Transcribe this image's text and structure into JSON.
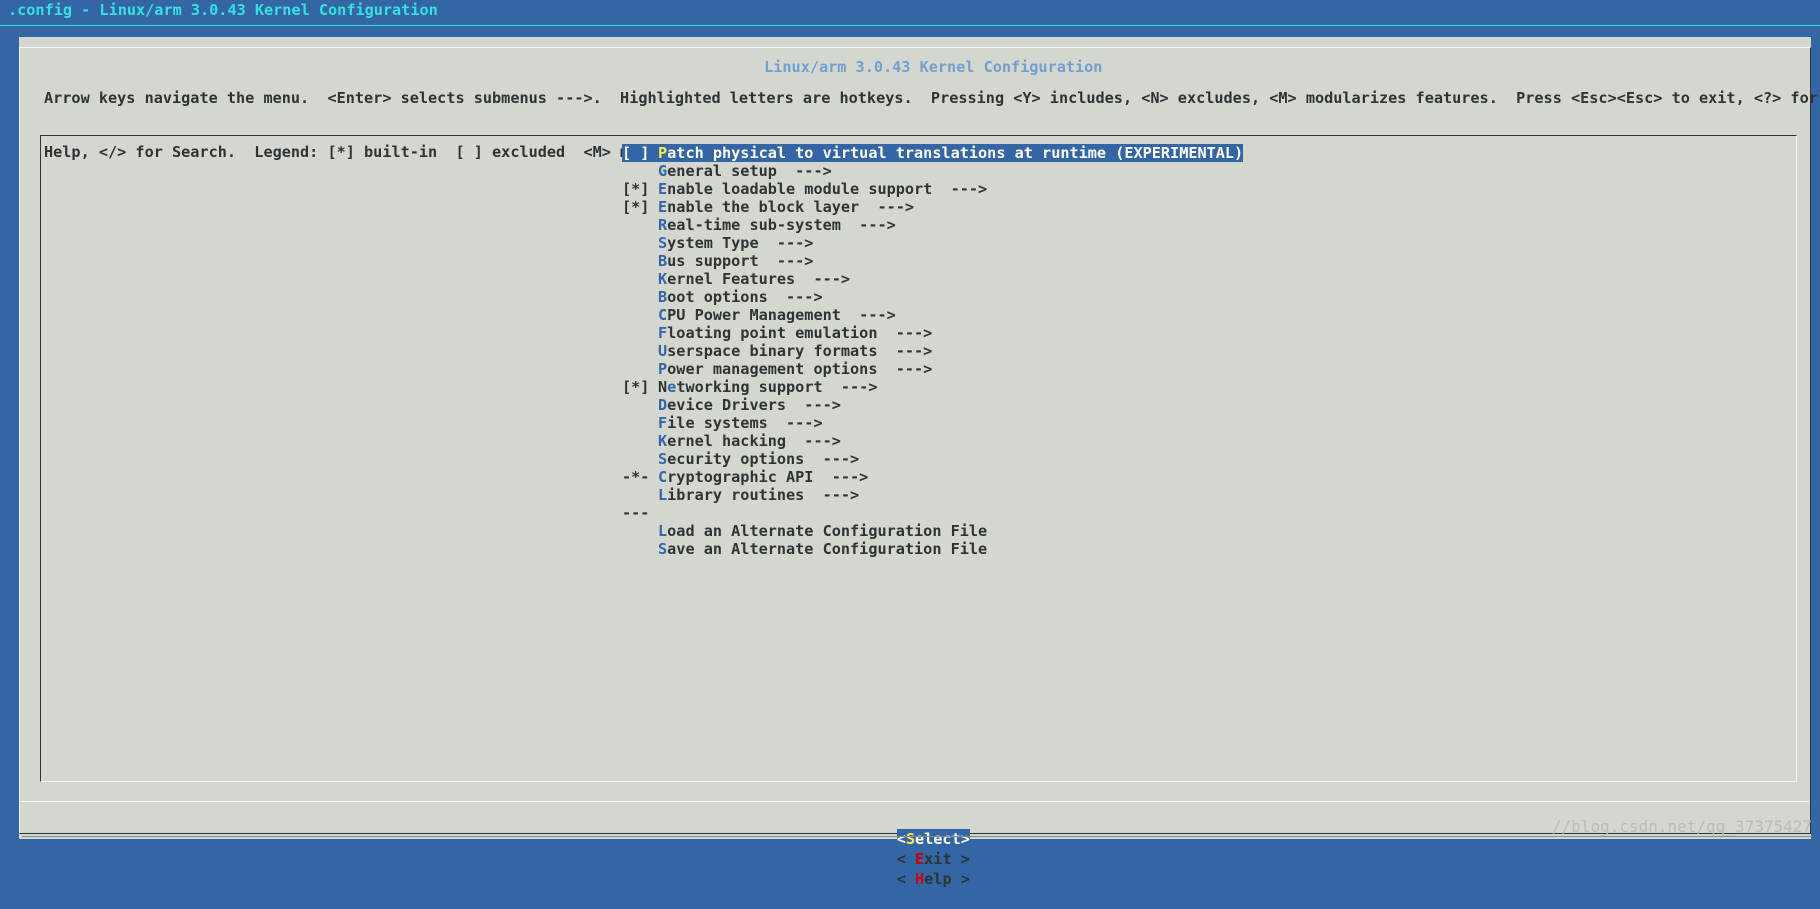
{
  "window": {
    "title": ".config - Linux/arm 3.0.43 Kernel Configuration"
  },
  "dialog": {
    "title": "Linux/arm 3.0.43 Kernel Configuration",
    "instructions": [
      "Arrow keys navigate the menu.  <Enter> selects submenus --->.  Highlighted letters are hotkeys.  Pressing <Y> includes, <N> excludes, <M> modularizes features.  Press <Esc><Esc> to exit, <?> for",
      "Help, </> for Search.  Legend: [*] built-in  [ ] excluded  <M> module  < > module capable"
    ]
  },
  "menu": {
    "selected_index": 0,
    "items": [
      {
        "prefix": "[ ]",
        "hotkey": "P",
        "rest": "atch physical to virtual translations at runtime (EXPERIMENTAL)",
        "selected": true
      },
      {
        "prefix": "",
        "hotkey": "G",
        "rest": "eneral setup  --->"
      },
      {
        "prefix": "[*]",
        "hotkey": "E",
        "rest": "nable loadable module support  --->"
      },
      {
        "prefix": "[*]",
        "hotkey": "E",
        "rest": "nable the block layer  --->"
      },
      {
        "prefix": "",
        "hotkey": "R",
        "rest": "eal-time sub-system  --->"
      },
      {
        "prefix": "",
        "hotkey": "S",
        "rest": "ystem Type  --->"
      },
      {
        "prefix": "",
        "hotkey": "B",
        "rest": "us support  --->"
      },
      {
        "prefix": "",
        "hotkey": "K",
        "rest": "ernel Features  --->"
      },
      {
        "prefix": "",
        "hotkey": "B",
        "rest": "oot options  --->"
      },
      {
        "prefix": "",
        "hotkey": "C",
        "rest": "PU Power Management  --->"
      },
      {
        "prefix": "",
        "hotkey": "F",
        "rest": "loating point emulation  --->"
      },
      {
        "prefix": "",
        "hotkey": "U",
        "rest": "serspace binary formats  --->"
      },
      {
        "prefix": "",
        "hotkey": "P",
        "rest": "ower management options  --->"
      },
      {
        "prefix": "[*]",
        "pre_hot": "N",
        "hotkey": "e",
        "rest": "tworking support  --->"
      },
      {
        "prefix": "",
        "hotkey": "D",
        "rest": "evice Drivers  --->"
      },
      {
        "prefix": "",
        "hotkey": "F",
        "rest": "ile systems  --->"
      },
      {
        "prefix": "",
        "hotkey": "K",
        "rest": "ernel hacking  --->"
      },
      {
        "prefix": "",
        "hotkey": "S",
        "rest": "ecurity options  --->"
      },
      {
        "prefix": "-*-",
        "hotkey": "C",
        "rest": "ryptographic API  --->"
      },
      {
        "prefix": "",
        "hotkey": "L",
        "rest": "ibrary routines  --->"
      },
      {
        "prefix": "---",
        "hotkey": "",
        "rest": ""
      },
      {
        "prefix": "",
        "hotkey": "L",
        "rest": "oad an Alternate Configuration File"
      },
      {
        "prefix": "",
        "hotkey": "S",
        "rest": "ave an Alternate Configuration File"
      }
    ]
  },
  "buttons": {
    "select": {
      "open": "<",
      "hotkey": "S",
      "rest": "elect>",
      "active": true
    },
    "exit": {
      "open": "< ",
      "hotkey": "E",
      "rest": "xit >"
    },
    "help": {
      "open": "< ",
      "hotkey": "H",
      "rest": "elp >"
    }
  },
  "watermark": "//blog.csdn.net/qq_37375427",
  "colors": {
    "background": "#3465a4",
    "dialog": "#d3d7cf",
    "hotkey": "#3465a4",
    "button_hotkey": "#cc0000",
    "selected_hotkey": "#fce94f",
    "title": "#729fcf",
    "top_title": "#34e2e2"
  }
}
